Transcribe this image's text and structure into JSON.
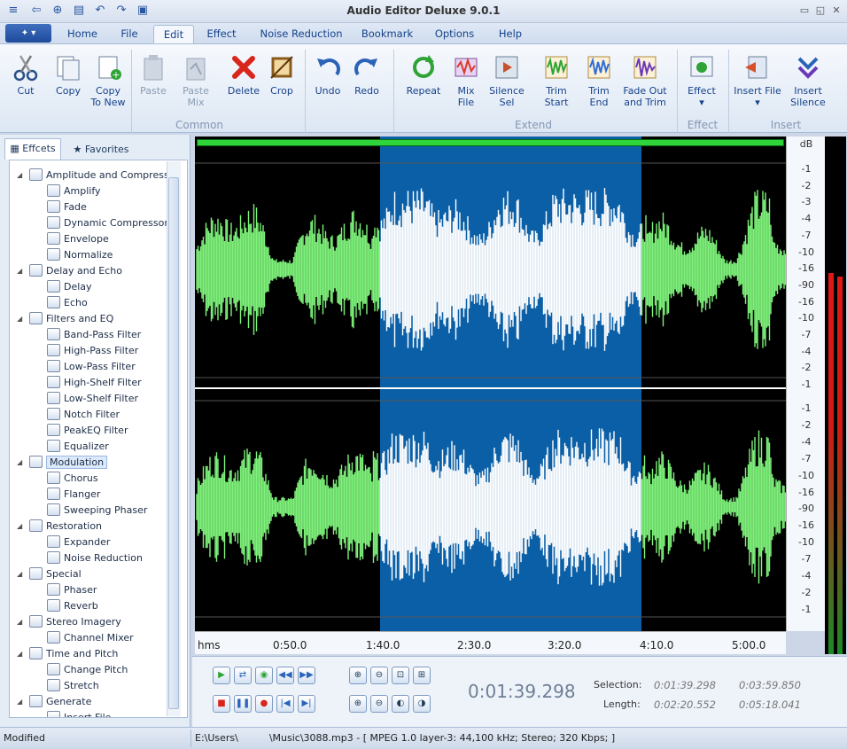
{
  "app": {
    "title": "Audio Editor Deluxe 9.0.1"
  },
  "menu_tabs": [
    "Home",
    "File",
    "Edit",
    "Effect",
    "Noise Reduction",
    "Bookmark",
    "Options",
    "Help"
  ],
  "active_tab": "Edit",
  "ribbon": {
    "cut": "Cut",
    "copy": "Copy",
    "copy_to_new_1": "Copy",
    "copy_to_new_2": "To New",
    "paste": "Paste",
    "paste_mix_1": "Paste",
    "paste_mix_2": "Mix",
    "delete": "Delete",
    "crop": "Crop",
    "undo": "Undo",
    "redo": "Redo",
    "repeat": "Repeat",
    "mix_file_1": "Mix",
    "mix_file_2": "File",
    "silence_sel_1": "Silence",
    "silence_sel_2": "Sel",
    "trim_start_1": "Trim",
    "trim_start_2": "Start",
    "trim_end_1": "Trim",
    "trim_end_2": "End",
    "fade_out_1": "Fade Out",
    "fade_out_2": "and Trim",
    "effect": "Effect",
    "insert_file": "Insert File",
    "insert_silence_1": "Insert",
    "insert_silence_2": "Silence",
    "groups": {
      "common": "Common",
      "extend": "Extend",
      "effect": "Effect",
      "insert": "Insert"
    }
  },
  "panel": {
    "tab_effects": "Effcets",
    "tab_favorites": "Favorites",
    "tree": [
      {
        "label": "Amplitude and Compressi",
        "level": 0
      },
      {
        "label": "Amplify",
        "level": 1
      },
      {
        "label": "Fade",
        "level": 1
      },
      {
        "label": "Dynamic Compressor",
        "level": 1
      },
      {
        "label": "Envelope",
        "level": 1
      },
      {
        "label": "Normalize",
        "level": 1
      },
      {
        "label": "Delay and Echo",
        "level": 0
      },
      {
        "label": "Delay",
        "level": 1
      },
      {
        "label": "Echo",
        "level": 1
      },
      {
        "label": "Filters and EQ",
        "level": 0
      },
      {
        "label": "Band-Pass Filter",
        "level": 1
      },
      {
        "label": "High-Pass Filter",
        "level": 1
      },
      {
        "label": "Low-Pass Filter",
        "level": 1
      },
      {
        "label": "High-Shelf Filter",
        "level": 1
      },
      {
        "label": "Low-Shelf Filter",
        "level": 1
      },
      {
        "label": "Notch Filter",
        "level": 1
      },
      {
        "label": "PeakEQ Filter",
        "level": 1
      },
      {
        "label": "Equalizer",
        "level": 1
      },
      {
        "label": "Modulation",
        "level": 0,
        "selected": true
      },
      {
        "label": "Chorus",
        "level": 1
      },
      {
        "label": "Flanger",
        "level": 1
      },
      {
        "label": "Sweeping Phaser",
        "level": 1
      },
      {
        "label": "Restoration",
        "level": 0
      },
      {
        "label": "Expander",
        "level": 1
      },
      {
        "label": "Noise Reduction",
        "level": 1
      },
      {
        "label": "Special",
        "level": 0
      },
      {
        "label": "Phaser",
        "level": 1
      },
      {
        "label": "Reverb",
        "level": 1
      },
      {
        "label": "Stereo Imagery",
        "level": 0
      },
      {
        "label": "Channel Mixer",
        "level": 1
      },
      {
        "label": "Time and Pitch",
        "level": 0
      },
      {
        "label": "Change Pitch",
        "level": 1
      },
      {
        "label": "Stretch",
        "level": 1
      },
      {
        "label": "Generate",
        "level": 0
      },
      {
        "label": "Insert File",
        "level": 1
      }
    ]
  },
  "db_scale": {
    "unit": "dB",
    "upper": [
      "-1",
      "-2",
      "-3",
      "-4",
      "-7",
      "-10",
      "-16",
      "-90",
      "-16",
      "-10",
      "-7",
      "-4",
      "-2",
      "-1"
    ],
    "lower": [
      "-1",
      "-2",
      "-4",
      "-7",
      "-10",
      "-16",
      "-90",
      "-16",
      "-10",
      "-7",
      "-4",
      "-2",
      "-1"
    ]
  },
  "timeline": {
    "unit": "hms",
    "ticks": [
      "0:50.0",
      "1:40.0",
      "2:30.0",
      "3:20.0",
      "4:10.0",
      "5:00.0"
    ]
  },
  "transport": {
    "timecode": "0:01:39.298",
    "selection_label": "Selection:",
    "length_label": "Length:",
    "selection_start": "0:01:39.298",
    "selection_end": "0:03:59.850",
    "length_sel": "0:02:20.552",
    "length_total": "0:05:18.041"
  },
  "status": {
    "state": "Modified",
    "file_info": "E:\\Users\\          \\Music\\3088.mp3 - [ MPEG 1.0 layer-3: 44,100 kHz; Stereo; 320 Kbps; ]"
  },
  "colors": {
    "waveform": "#7ef27a",
    "selected_wave": "#ffffff",
    "selection_bg": "#0b5fa6",
    "meter_red": "#e01818",
    "meter_green": "#1a8a24"
  }
}
